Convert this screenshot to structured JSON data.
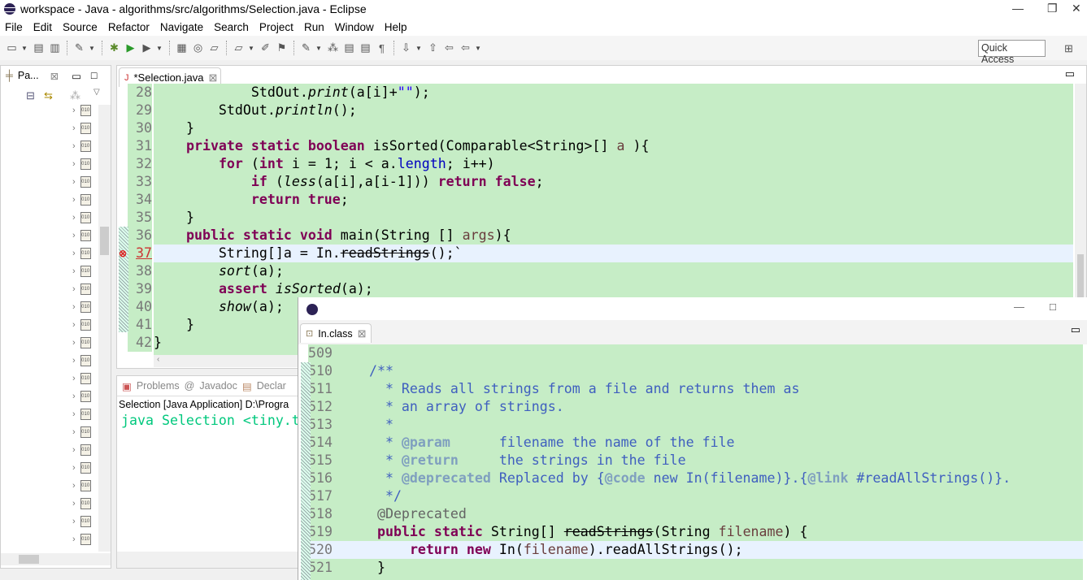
{
  "window": {
    "title": "workspace - Java - algorithms/src/algorithms/Selection.java - Eclipse",
    "minimize": "—",
    "maximize": "❐",
    "close": "✕"
  },
  "menu": [
    "File",
    "Edit",
    "Source",
    "Refactor",
    "Navigate",
    "Search",
    "Project",
    "Run",
    "Window",
    "Help"
  ],
  "toolbar": {
    "quick_access": "Quick Access",
    "icons": [
      "new-icon",
      "save-icon",
      "save-all-icon",
      "skip-breakpoints-icon",
      "debug-icon",
      "run-icon",
      "external-tools-icon",
      "new-package-icon",
      "new-class-icon",
      "open-type-icon",
      "open-task-icon",
      "search-icon",
      "toggle-mark-occurrences-icon",
      "toggle-highlight-icon",
      "word-wrap-icon",
      "block-selection-icon",
      "show-whitespace-icon",
      "next-annotation-icon",
      "prev-annotation-icon",
      "last-edit-icon",
      "back-icon",
      "forward-icon"
    ]
  },
  "package_explorer": {
    "tab_label": "Pa...",
    "close": "⊠",
    "minimize": "▭",
    "maximize": "□",
    "item_icon": "jar-icon"
  },
  "editor": {
    "tab_label": "*Selection.java",
    "close": "⊠",
    "minimize": "▭",
    "lines": [
      {
        "n": "28",
        "tokens": [
          [
            "",
            "            StdOut."
          ],
          [
            "it",
            "print"
          ],
          [
            "",
            "(a[i]+"
          ],
          [
            "s",
            "\"\""
          ],
          [
            "",
            ");"
          ]
        ]
      },
      {
        "n": "29",
        "tokens": [
          [
            "",
            "        StdOut."
          ],
          [
            "it",
            "println"
          ],
          [
            "",
            "();"
          ]
        ]
      },
      {
        "n": "30",
        "tokens": [
          [
            "",
            "    }"
          ]
        ]
      },
      {
        "n": "31",
        "tokens": [
          [
            "",
            "    "
          ],
          [
            "k",
            "private static boolean"
          ],
          [
            "",
            " isSorted(Comparable<String>[] "
          ],
          [
            "p",
            "a"
          ],
          [
            "",
            " ){"
          ]
        ]
      },
      {
        "n": "32",
        "tokens": [
          [
            "",
            "        "
          ],
          [
            "k",
            "for"
          ],
          [
            "",
            " ("
          ],
          [
            "k",
            "int"
          ],
          [
            "",
            " i = 1; i < a."
          ],
          [
            "f",
            "length"
          ],
          [
            "",
            "; i++)"
          ]
        ]
      },
      {
        "n": "33",
        "tokens": [
          [
            "",
            "            "
          ],
          [
            "k",
            "if"
          ],
          [
            "",
            " ("
          ],
          [
            "it",
            "less"
          ],
          [
            "",
            "(a[i],a[i-1])) "
          ],
          [
            "k",
            "return false"
          ],
          [
            "",
            ";"
          ]
        ]
      },
      {
        "n": "34",
        "tokens": [
          [
            "",
            "            "
          ],
          [
            "k",
            "return true"
          ],
          [
            "",
            ";"
          ]
        ]
      },
      {
        "n": "35",
        "tokens": [
          [
            "",
            "    }"
          ]
        ]
      },
      {
        "n": "36",
        "tokens": [
          [
            "",
            "    "
          ],
          [
            "k",
            "public static void"
          ],
          [
            "",
            " main(String [] "
          ],
          [
            "p",
            "args"
          ],
          [
            "",
            "){"
          ]
        ]
      },
      {
        "n": "37",
        "current": true,
        "error": true,
        "tokens": [
          [
            "",
            "        String[]a = In."
          ],
          [
            "st",
            "readStrings"
          ],
          [
            "",
            "();`"
          ]
        ]
      },
      {
        "n": "38",
        "tokens": [
          [
            "",
            "        "
          ],
          [
            "it",
            "sort"
          ],
          [
            "",
            "(a);"
          ]
        ]
      },
      {
        "n": "39",
        "tokens": [
          [
            "",
            "        "
          ],
          [
            "k",
            "assert"
          ],
          [
            "",
            " "
          ],
          [
            "it",
            "isSorted"
          ],
          [
            "",
            "(a);"
          ]
        ]
      },
      {
        "n": "40",
        "tokens": [
          [
            "",
            "        "
          ],
          [
            "it",
            "show"
          ],
          [
            "",
            "(a);"
          ]
        ]
      },
      {
        "n": "41",
        "tokens": [
          [
            "",
            "    }"
          ]
        ]
      },
      {
        "n": "42",
        "tokens": [
          [
            "",
            "}"
          ]
        ]
      }
    ]
  },
  "console": {
    "tabs": [
      "Problems",
      "Javadoc",
      "Declar"
    ],
    "launch": "Selection [Java Application] D:\\Progra",
    "output": "java Selection <tiny.t"
  },
  "in_class": {
    "tab_label": "In.class",
    "close": "⊠",
    "minimize": "▭",
    "maximize": "□",
    "lines": [
      {
        "n": "509",
        "tokens": []
      },
      {
        "n": "510",
        "tokens": [
          [
            "c",
            "   /**"
          ]
        ]
      },
      {
        "n": "511",
        "tokens": [
          [
            "c",
            "     * Reads all strings from a file and returns them as"
          ]
        ]
      },
      {
        "n": "512",
        "tokens": [
          [
            "c",
            "     * an array of strings."
          ]
        ]
      },
      {
        "n": "513",
        "tokens": [
          [
            "c",
            "     *"
          ]
        ]
      },
      {
        "n": "514",
        "tokens": [
          [
            "c",
            "     * "
          ],
          [
            "t",
            "@param"
          ],
          [
            "c",
            "      filename the name of the file"
          ]
        ]
      },
      {
        "n": "515",
        "tokens": [
          [
            "c",
            "     * "
          ],
          [
            "t",
            "@return"
          ],
          [
            "c",
            "     the strings in the file"
          ]
        ]
      },
      {
        "n": "516",
        "tokens": [
          [
            "c",
            "     * "
          ],
          [
            "t",
            "@deprecated"
          ],
          [
            "c",
            " Replaced by {"
          ],
          [
            "t",
            "@code"
          ],
          [
            "c",
            " new In(filename)}.{"
          ],
          [
            "t",
            "@link"
          ],
          [
            "c",
            " #readAllStrings()}."
          ]
        ]
      },
      {
        "n": "517",
        "tokens": [
          [
            "c",
            "     */"
          ]
        ]
      },
      {
        "n": "518",
        "tokens": [
          [
            "a",
            "    @Deprecated"
          ]
        ]
      },
      {
        "n": "519",
        "tokens": [
          [
            "",
            "    "
          ],
          [
            "k",
            "public static"
          ],
          [
            "",
            " String[] "
          ],
          [
            "st",
            "readStrings"
          ],
          [
            "",
            "(String "
          ],
          [
            "p",
            "filename"
          ],
          [
            "",
            ") {"
          ]
        ]
      },
      {
        "n": "520",
        "current": true,
        "tokens": [
          [
            "",
            "        "
          ],
          [
            "k",
            "return new"
          ],
          [
            "",
            " In("
          ],
          [
            "p",
            "filename"
          ],
          [
            "",
            ").readAllStrings();"
          ]
        ]
      },
      {
        "n": "521",
        "tokens": [
          [
            "",
            "    }"
          ]
        ]
      }
    ]
  },
  "colors": {
    "editor_bg": "#c6edc6",
    "current_line": "#e8f2fe",
    "keyword": "#7f0055",
    "javadoc": "#3f5fbf",
    "console_output": "#00c87d"
  }
}
